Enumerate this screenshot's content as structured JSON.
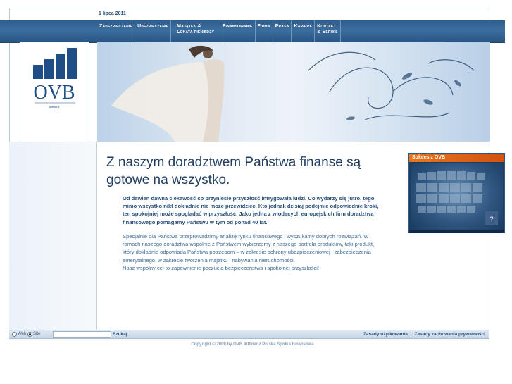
{
  "header": {
    "date": "1 lipca 2011"
  },
  "brand": {
    "name": "OVB",
    "tagline": "Allfinanz"
  },
  "nav": {
    "items": [
      {
        "label": "Zabezpieczenie"
      },
      {
        "label": "Ubezpieczenie"
      },
      {
        "label": "Majątek &",
        "label2": "Lokata pieniędzy"
      },
      {
        "label": "Finansowanie"
      },
      {
        "label": "Firma"
      },
      {
        "label": "Prasa"
      },
      {
        "label": "Kariera"
      },
      {
        "label": "Kontakt",
        "label2": "& Serwis"
      }
    ]
  },
  "main": {
    "heading": "Z naszym doradztwem Państwa finanse są gotowe na wszystko.",
    "lead": "Od dawien dawna ciekawość co przyniesie przyszłość intrygowała ludzi. Co wydarzy się jutro, tego mimo wszystko nikt dokładnie nie może przewidzieć. Kto jednak dzisiaj podejmie odpowiednie kroki, ten spokojniej może spoglądać w przyszłość. Jako jedna z wiodących europejskich firm doradztwa finansowego pomagamy Państwu w tym od ponad 40 lat.",
    "body": "Specjalnie dla Państwa przeprowadzimy analizę rynku finansowego i wyszukamy dobrych rozwiązań. W ramach naszego doradztwa wspólnie z Państwem wybierzemy z naszego portfela produktów, taki produkt, który dokładnie odpowiada Państwa potrzebom – w zakresie ochrony ubezpieczeniowej i zabezpieczenia emerytalnego, w zakresie tworzenia majątku i nabywania nieruchomości.",
    "body2": "Nasz wspólny cel to zapewnienie poczucia bezpieczeństwa i spokojnej przyszłości!"
  },
  "video": {
    "title": "Sukces z OVB"
  },
  "footer": {
    "radio_web": "Web",
    "radio_site": "Site",
    "search_value": "",
    "search_button": "Szukaj",
    "link_terms": "Zasady użytkowania",
    "link_privacy": "Zasady zachowania prywatności",
    "copyright": "Copyright © 2009 by OVB Allfinanz Polska Spółka Finansowa"
  },
  "colors": {
    "nav": "#2e5e8e",
    "brand": "#1f4e86",
    "accent": "#e8741e",
    "heading": "#1f3e62"
  }
}
